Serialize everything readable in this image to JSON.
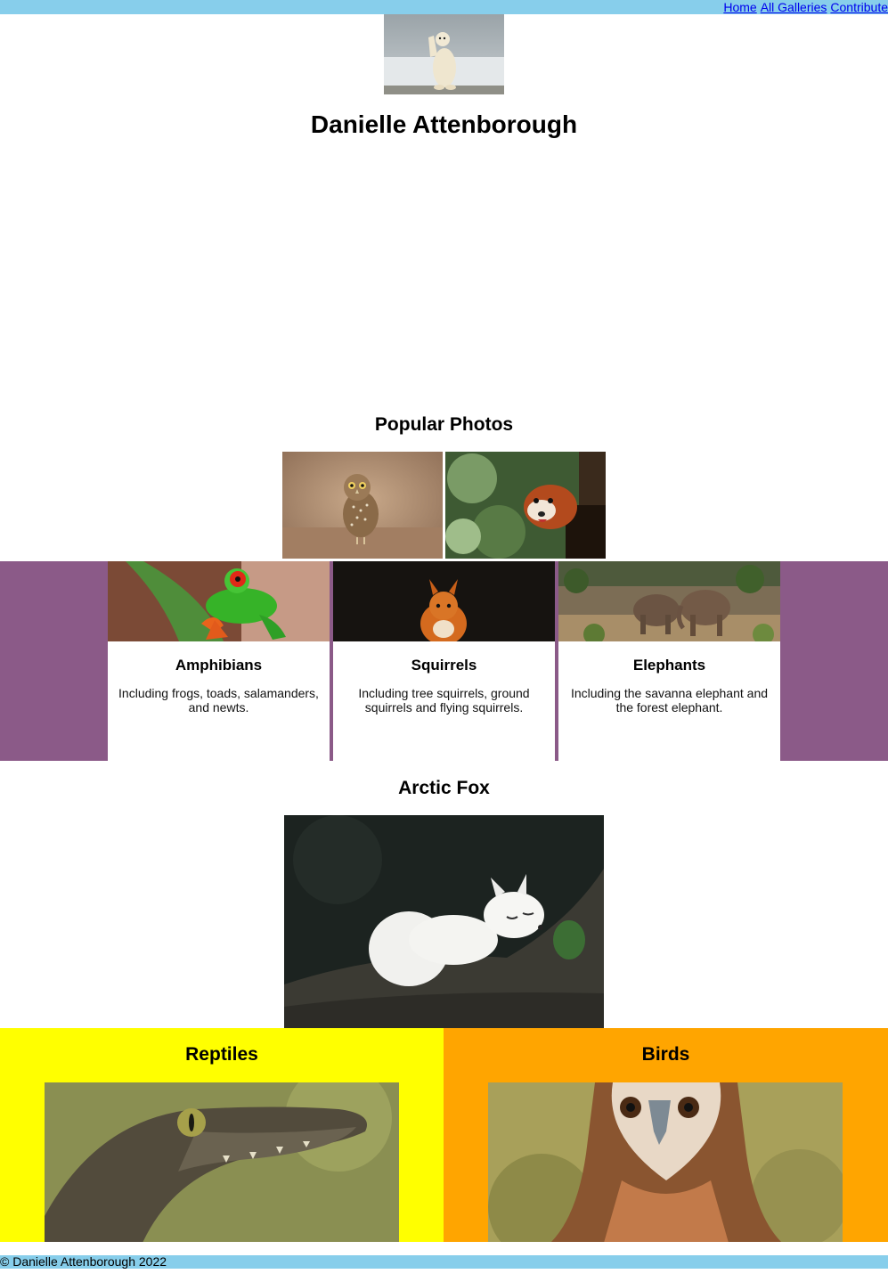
{
  "nav": {
    "links": [
      "Home",
      "All Galleries",
      "Contribute"
    ]
  },
  "header": {
    "title": "Danielle Attenborough"
  },
  "popular": {
    "title": "Popular Photos"
  },
  "categories": [
    {
      "title": "Amphibians",
      "description": "Including frogs, toads, salamanders, and newts."
    },
    {
      "title": "Squirrels",
      "description": "Including tree squirrels, ground squirrels and flying squirrels."
    },
    {
      "title": "Elephants",
      "description": "Including the savanna elephant and the forest elephant."
    }
  ],
  "feature": {
    "title": "Arctic Fox"
  },
  "panels": [
    {
      "title": "Reptiles"
    },
    {
      "title": "Birds"
    }
  ],
  "footer": {
    "text": "© Danielle Attenborough 2022"
  },
  "colors": {
    "nav_bar": "#87ceeb",
    "category_band": "#8b5a88",
    "reptiles_panel": "#ffff00",
    "birds_panel": "#ffa500",
    "link": "#0000ee"
  }
}
